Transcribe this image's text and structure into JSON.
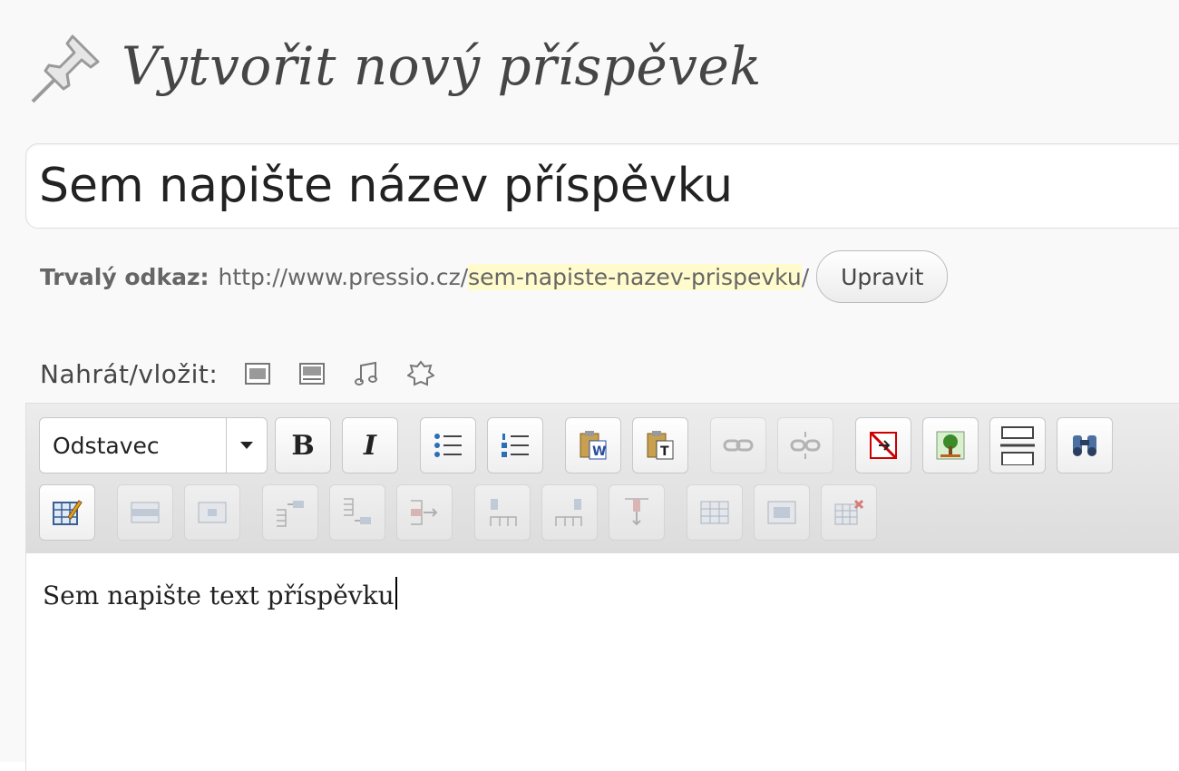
{
  "heading": {
    "title": "Vytvořit nový příspěvek",
    "icon": "pushpin-icon"
  },
  "title_input": {
    "value": "Sem napište název příspěvku"
  },
  "permalink": {
    "label": "Trvalý odkaz:",
    "base": "http://www.pressio.cz/",
    "slug": "sem-napiste-nazev-prispevku",
    "trailing": "/",
    "edit_label": "Upravit",
    "slug_highlight_color": "#fffbcc"
  },
  "upload": {
    "label": "Nahrát/vložit:",
    "icons": [
      "image-icon",
      "video-icon",
      "music-icon",
      "media-icon"
    ]
  },
  "toolbar": {
    "format_value": "Odstavec",
    "bold_label": "B",
    "italic_label": "I",
    "row1_icons": [
      "bullet-list-icon",
      "numbered-list-icon",
      "paste-word-icon",
      "paste-text-icon",
      "link-icon",
      "unlink-icon",
      "remove-format-icon",
      "insert-image-icon",
      "horizontal-rule-icon",
      "search-icon"
    ],
    "row2_icons": [
      "table-props-icon",
      "row-props-icon",
      "cell-props-icon",
      "row-before-icon",
      "row-after-icon",
      "delete-row-icon",
      "col-before-icon",
      "col-after-icon",
      "delete-col-icon",
      "split-cells-icon",
      "merge-cells-icon",
      "delete-table-icon"
    ]
  },
  "editor": {
    "content": "Sem napište text příspěvku"
  }
}
